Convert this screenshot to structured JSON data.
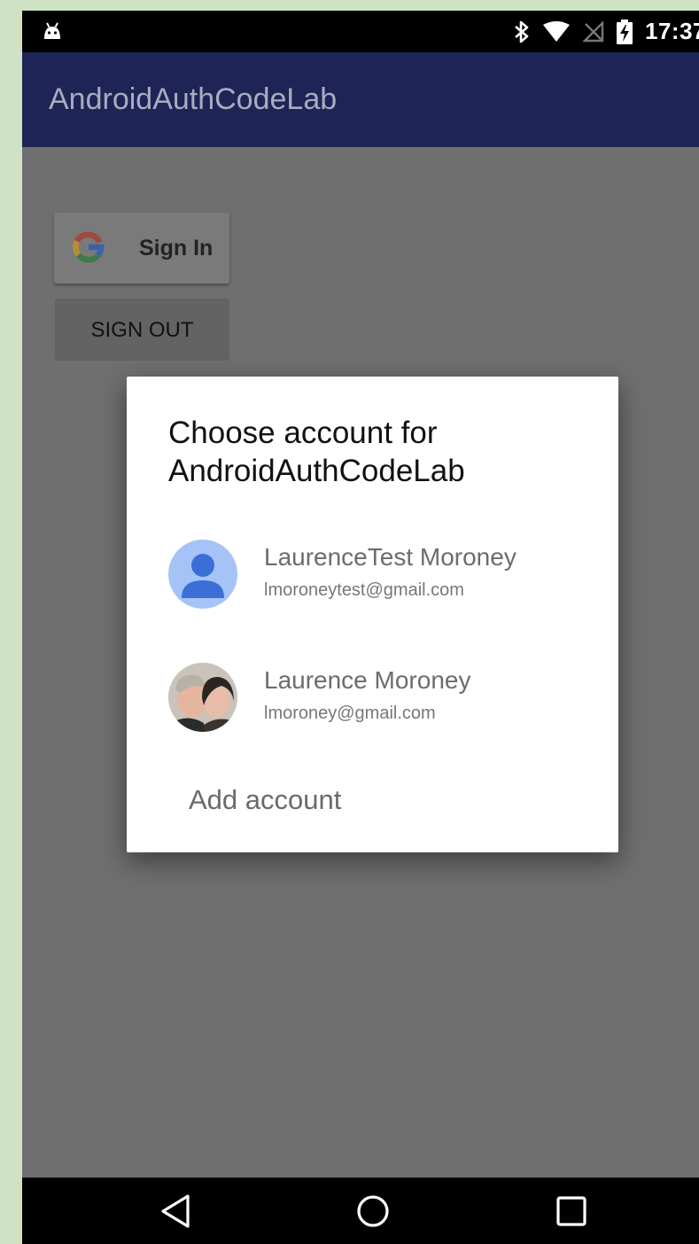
{
  "status_bar": {
    "time": "17:37",
    "icons": [
      "android-debug-icon",
      "bluetooth-icon",
      "wifi-icon",
      "no-signal-icon",
      "battery-charging-icon"
    ]
  },
  "app_bar": {
    "title": "AndroidAuthCodeLab"
  },
  "main": {
    "sign_in_label": "Sign In",
    "sign_out_label": "SIGN OUT"
  },
  "dialog": {
    "title": "Choose account for AndroidAuthCodeLab",
    "accounts": [
      {
        "name": "LaurenceTest Moroney",
        "email": "lmoroneytest@gmail.com",
        "avatar": "default-person-avatar"
      },
      {
        "name": "Laurence Moroney",
        "email": "lmoroney@gmail.com",
        "avatar": "photo-avatar"
      }
    ],
    "add_account_label": "Add account"
  },
  "nav_bar": {
    "buttons": [
      "back-icon",
      "home-icon",
      "recents-icon"
    ]
  },
  "colors": {
    "app_bar": "#1e2455",
    "scrim": "#6f6f6f",
    "dialog_bg": "#ffffff",
    "avatar_blue": "#a5c3f7"
  }
}
